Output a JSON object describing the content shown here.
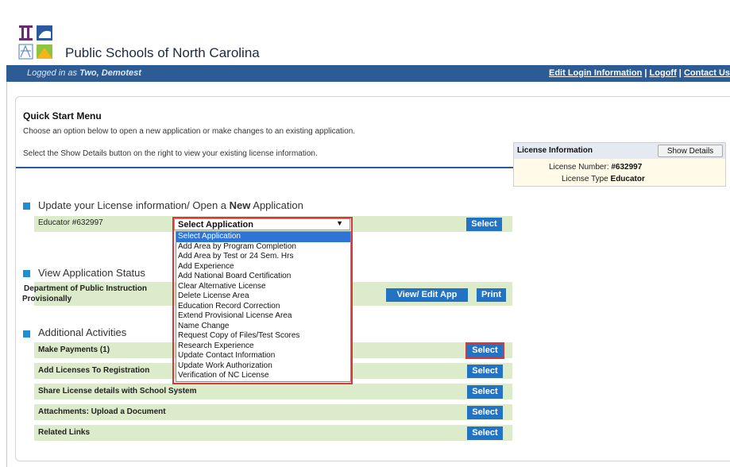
{
  "header": {
    "site_title": "Public Schools of North Carolina",
    "logged_in_prefix": "Logged in as ",
    "logged_in_user": "Two, Demotest",
    "nav_links": [
      "Edit Login Information",
      "Logoff",
      "Contact Us"
    ],
    "nav_separator": " | "
  },
  "quick_start": {
    "title": "Quick Start Menu",
    "description1": "Choose an option below to open a new application or make changes to an existing application.",
    "description2": "Select the Show Details button on the right to view your existing license information."
  },
  "license_info": {
    "title": "License Information",
    "show_details_label": "Show Details",
    "number_label": "License Number:",
    "number_value": "#632997",
    "type_label": "License Type",
    "type_value": "Educator"
  },
  "update_section": {
    "title_prefix": "Update your License information/ Open a ",
    "title_bold": "New",
    "title_suffix": " Application",
    "educator_label": "Educator  #632997",
    "select_label": "Select",
    "dropdown_value": "Select Application",
    "dropdown_options": [
      "Select Application",
      "Add Area by Program Completion",
      "Add Area by Test or 24 Sem. Hrs",
      "Add Experience",
      "Add National Board Certification",
      "Clear Alternative License",
      "Delete License Area",
      "Education Record Correction",
      "Extend Provisional License Area",
      "Name Change",
      "Request Copy of Files/Test Scores",
      "Research Experience",
      "Update Contact Information",
      "Update Work Authorization",
      "Verification of NC License"
    ]
  },
  "status_section": {
    "title": "View Application Status",
    "row_line1": "Department of Public Instruction",
    "row_line2": "Provisionally",
    "view_edit_label": "View/ Edit App",
    "print_label": "Print"
  },
  "additional_section": {
    "title": "Additional Activities",
    "rows": [
      {
        "label": "Make Payments (1)",
        "button": "Select"
      },
      {
        "label": "Add Licenses To Registration",
        "button": "Select"
      },
      {
        "label": "Share License details with School System",
        "button": "Select"
      },
      {
        "label": "Attachments: Upload a Document",
        "button": "Select"
      },
      {
        "label": "Related Links",
        "button": "Select"
      }
    ]
  },
  "colors": {
    "navbar": "#2d5b94",
    "row_bg": "#dcebc9",
    "button": "#2273c3",
    "highlight": "#d9383a",
    "bullet": "#1e8fd6"
  }
}
